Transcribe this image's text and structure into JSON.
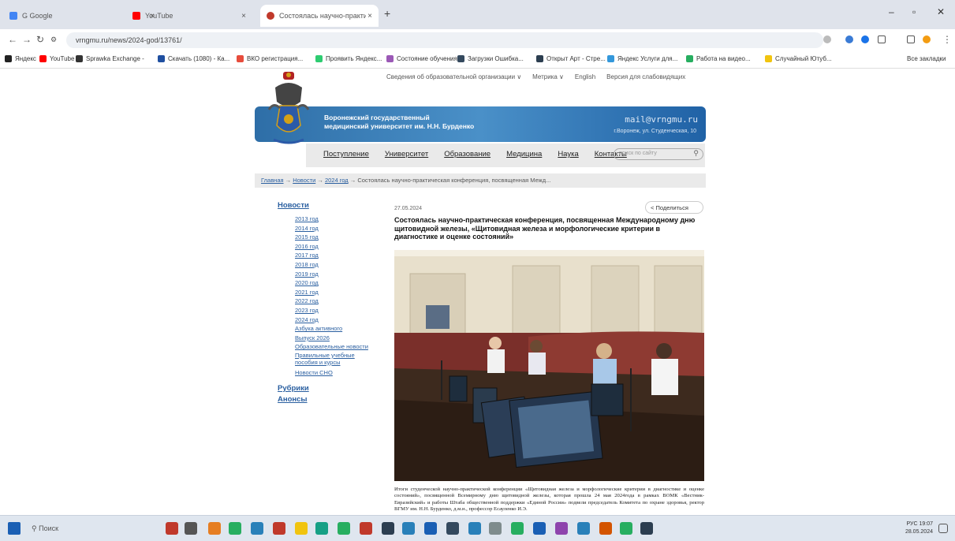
{
  "browser": {
    "tabs": [
      {
        "label": "G Google",
        "color": "#4285f4"
      },
      {
        "label": "YouTube",
        "color": "#ff0000"
      },
      {
        "label": "Состоялась научно-практич...",
        "color": "#c0392b"
      }
    ],
    "url": "vrngmu.ru/news/2024-god/13761/",
    "bookmarks": [
      {
        "label": "Яндекс",
        "color": "#222"
      },
      {
        "label": "YouTube",
        "color": "#ff0000"
      },
      {
        "label": "Sprawka Exchange -",
        "color": "#333"
      },
      {
        "label": "Скачать (1080) - Ка...",
        "color": "#1f4fa0"
      },
      {
        "label": "ВКО регистрация...",
        "color": "#e74c3c"
      },
      {
        "label": "Проявить Яндекс...",
        "color": "#2ecc71"
      },
      {
        "label": "Состояние обучения...",
        "color": "#9b59b6"
      },
      {
        "label": "Загрузки Ошибка...",
        "color": "#34495e"
      },
      {
        "label": "Открыт Арт - Стре...",
        "color": "#2c3e50"
      },
      {
        "label": "Яндекс Услуги для...",
        "color": "#3498db"
      },
      {
        "label": "Работа на видео...",
        "color": "#27ae60"
      },
      {
        "label": "Случайный Ютуб...",
        "color": "#f1c40f"
      }
    ],
    "all_bookmarks": "Все закладки"
  },
  "site": {
    "top_links": [
      "Сведения об образовательной организации ∨",
      "Метрика ∨",
      "English",
      "Версия для слабовидящих"
    ],
    "title_line1": "Воронежский государственный",
    "title_line2": "медицинский университет им. Н.Н. Бурденко",
    "email": "mail@vrngmu.ru",
    "address": "г.Воронеж, ул. Студенческая, 10",
    "nav": [
      "Поступление",
      "Университет",
      "Образование",
      "Медицина",
      "Наука",
      "Контакты"
    ],
    "search_placeholder": "поиск по сайту",
    "breadcrumb": {
      "links": [
        "Главная",
        "Новости",
        "2024 год"
      ],
      "current": "Состоялась научно-практическая конференция, посвященная Межд..."
    }
  },
  "sidebar": {
    "heading": "Новости",
    "years": [
      "2013 год",
      "2014 год",
      "2015 год",
      "2016 год",
      "2017 год",
      "2018 год",
      "2019 год",
      "2020 год",
      "2021 год",
      "2022 год",
      "2023 год",
      "2024 год"
    ],
    "extra": [
      "Азбука активного",
      "Выпуск 2026",
      "Образовательные новости",
      "Правильные учебные пособия и курсы",
      "Новости СНО"
    ],
    "sections": [
      "Рубрики",
      "Анонсы"
    ]
  },
  "article": {
    "date": "27.05.2024",
    "share": "Поделиться",
    "title": "Состоялась научно-практическая конференция, посвященная Международному дню щитовидной железы, «Щитовидная железа и морфологические критерии в диагностике и оценке состояний»",
    "body": "Итоги студенческой научно-практической конференции «Щитовидная железа и морфологические критерии в диагностике и оценке состояний», посвященной Всемирному дню щитовидной железы, которая прошла 24 мая 2024года в рамках ВОМК «Вестник-Евразийский» и работы Штаба общественной поддержки «Единой России» подвели председатель Комитета по охране здоровья, ректор ВГМУ им. Н.Н. Бурденко, д.м.н., профессор Есауленко И.Э."
  },
  "taskbar": {
    "search": "Поиск",
    "lang": "РУС",
    "time": "19:07",
    "date": "28.05.2024"
  }
}
